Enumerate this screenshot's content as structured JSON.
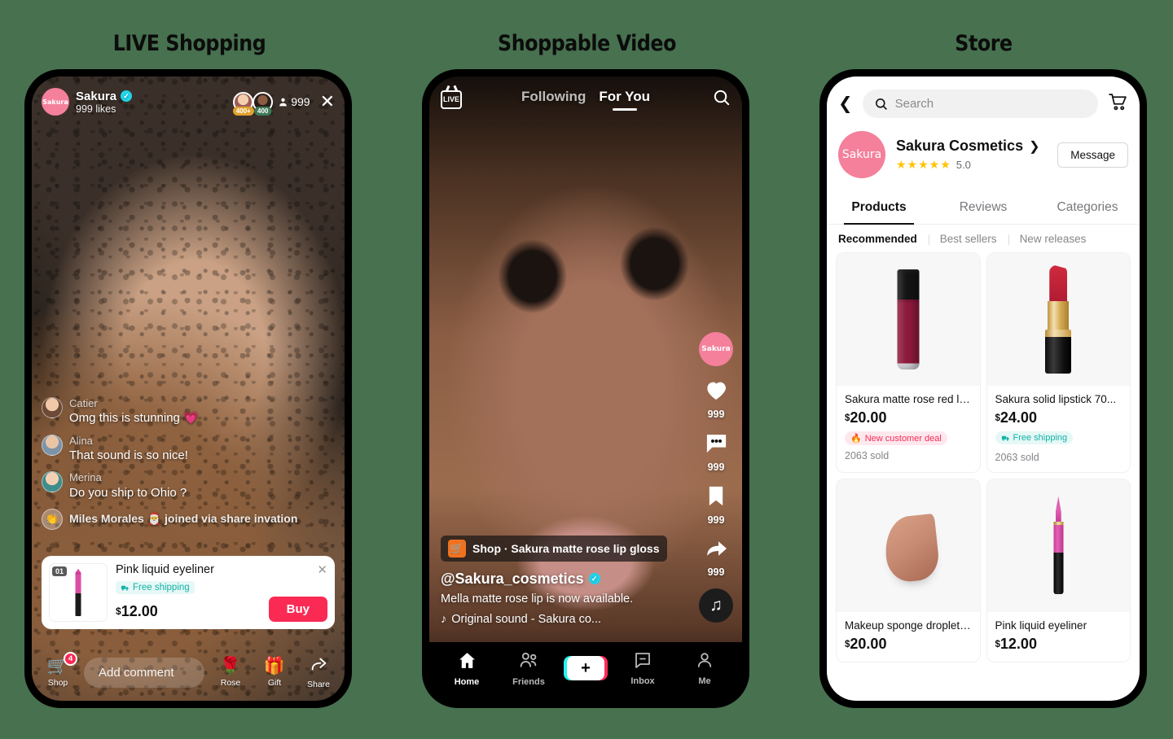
{
  "background_color": "#47714f",
  "sections": [
    {
      "title": "LIVE Shopping"
    },
    {
      "title": "Shoppable Video"
    },
    {
      "title": "Store"
    }
  ],
  "live": {
    "host": {
      "avatar_label": "Sakura",
      "name": "Sakura",
      "likes": "999 likes",
      "verified_icon": "verified-badge-icon"
    },
    "viewers": {
      "avatar1_badge": "400+",
      "avatar2_badge": "400",
      "person_icon": "person-icon",
      "count": "999",
      "close_icon": "close-icon"
    },
    "comments": [
      {
        "name": "Catier",
        "text": "Omg this is stunning 💗"
      },
      {
        "name": "Alina",
        "text": "That sound is so nice!"
      },
      {
        "name": "Merina",
        "text": "Do you ship to Ohio ?"
      }
    ],
    "join_notice": "Miles Morales 🎅 joined via share invation",
    "product": {
      "index": "01",
      "title": "Pink liquid eyeliner",
      "shipping_chip": "Free shipping",
      "shipping_icon": "truck-icon",
      "price": "12.00",
      "currency": "$",
      "buy_label": "Buy",
      "close_icon": "close-icon"
    },
    "bottom_bar": {
      "shop_label": "Shop",
      "shop_icon": "shopping-cart-icon",
      "shop_badge": "4",
      "comment_placeholder": "Add comment",
      "actions": [
        {
          "label": "Rose",
          "icon": "rose-icon",
          "glyph": "🌹"
        },
        {
          "label": "Gift",
          "icon": "gift-icon",
          "glyph": "🎁"
        },
        {
          "label": "Share",
          "icon": "share-arrow-icon",
          "glyph": "↪"
        }
      ]
    }
  },
  "video": {
    "live_badge": "LIVE",
    "live_icon": "live-tv-icon",
    "tabs": [
      {
        "label": "Following",
        "active": false
      },
      {
        "label": "For You",
        "active": true
      }
    ],
    "search_icon": "search-icon",
    "rail": {
      "avatar_label": "Sakura",
      "follow_icon": "plus-icon",
      "items": [
        {
          "icon": "heart-icon",
          "count": "999"
        },
        {
          "icon": "comment-icon",
          "count": "999"
        },
        {
          "icon": "bookmark-icon",
          "count": "999"
        },
        {
          "icon": "share-arrow-icon",
          "count": "999"
        }
      ],
      "music_disc_icon": "tiktok-note-icon"
    },
    "shop_tag": {
      "icon": "shopping-cart-icon",
      "text": "Shop · Sakura matte rose lip gloss"
    },
    "username": "@Sakura_cosmetics",
    "verified_icon": "verified-badge-icon",
    "description": "Mella matte rose lip is now available.",
    "sound_icon": "music-note-icon",
    "sound": "Original sound - Sakura co...",
    "nav": [
      {
        "label": "Home",
        "icon": "home-icon",
        "active": true
      },
      {
        "label": "Friends",
        "icon": "friends-icon",
        "active": false
      },
      {
        "label": "",
        "icon": "create-plus-icon",
        "active": false
      },
      {
        "label": "Inbox",
        "icon": "inbox-icon",
        "active": false
      },
      {
        "label": "Me",
        "icon": "profile-icon",
        "active": false
      }
    ]
  },
  "store": {
    "back_icon": "chevron-left-icon",
    "search_icon": "search-icon",
    "search_placeholder": "Search",
    "cart_icon": "shopping-cart-icon",
    "shop": {
      "avatar_label": "Sakura",
      "name": "Sakura Cosmetics",
      "chevron_icon": "chevron-right-icon",
      "stars": "★★★★★",
      "rating": "5.0",
      "message_label": "Message"
    },
    "tabs": [
      {
        "label": "Products",
        "active": true
      },
      {
        "label": "Reviews",
        "active": false
      },
      {
        "label": "Categories",
        "active": false
      }
    ],
    "filters": [
      {
        "label": "Recommended",
        "active": true
      },
      {
        "label": "Best sellers",
        "active": false
      },
      {
        "label": "New releases",
        "active": false
      }
    ],
    "products": [
      {
        "art": "gloss",
        "name": "Sakura matte rose red li ...",
        "currency": "$",
        "price": "20.00",
        "badge": "New customer deal",
        "badge_type": "deal",
        "badge_icon": "flame-icon",
        "sold": "2063 sold"
      },
      {
        "art": "lipstick",
        "name": "Sakura solid lipstick 70...",
        "currency": "$",
        "price": "24.00",
        "badge": "Free shipping",
        "badge_type": "ship",
        "badge_icon": "truck-icon",
        "sold": "2063 sold"
      },
      {
        "art": "sponge",
        "name": "Makeup sponge droplet ...",
        "currency": "$",
        "price": "20.00",
        "badge": "",
        "badge_type": "",
        "badge_icon": "",
        "sold": ""
      },
      {
        "art": "liner",
        "name": "Pink liquid eyeliner",
        "currency": "$",
        "price": "12.00",
        "badge": "",
        "badge_type": "",
        "badge_icon": "",
        "sold": ""
      }
    ]
  },
  "colors": {
    "accent_pink": "#fa2a55",
    "brand_avatar": "#f4809c",
    "verified_blue": "#20d5ec",
    "teal_chip": "#12b2a6",
    "star_gold": "#ffc300",
    "orange_cart": "#f0721f"
  }
}
